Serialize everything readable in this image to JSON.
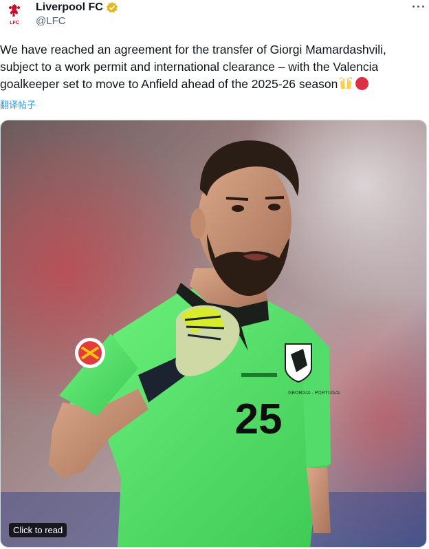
{
  "account": {
    "display_name": "Liverpool FC",
    "handle": "@LFC",
    "verified_badge": "verified-gold-badge-icon",
    "logo_text": "LFC"
  },
  "tweet": {
    "text": "We have reached an agreement for the transfer of Giorgi Mamardashvili, subject to a work permit and international clearance – with the Valencia goalkeeper set to move to Anfield ahead of the 2025-26 season",
    "emojis": [
      "raising-hands",
      "red-circle"
    ],
    "translate_label": "翻译帖子"
  },
  "media": {
    "badge_label": "Click to read",
    "shirt_number": "25",
    "shirt_text": "GEORGIA · PORTUGAL",
    "description_icons": [
      "goalkeeper-photo"
    ]
  },
  "colors": {
    "accent_blue": "#1d9bf0",
    "jersey_green": "#5ee872",
    "lfc_red": "#c8102e"
  }
}
